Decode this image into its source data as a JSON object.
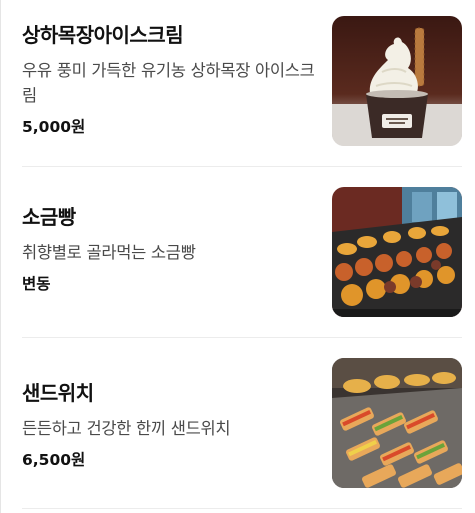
{
  "menu": {
    "items": [
      {
        "name": "상하목장아이스크림",
        "description": "우유 풍미 가득한 유기농 상하목장 아이스크림",
        "price": "5,000원",
        "image": "ice-cream-cup-photo"
      },
      {
        "name": "소금빵",
        "description": "취향별로 골라먹는 소금빵",
        "price": "변동",
        "image": "salt-bread-display-photo"
      },
      {
        "name": "샌드위치",
        "description": "든든하고 건강한 한끼 샌드위치",
        "price": "6,500원",
        "image": "sandwich-display-photo"
      }
    ]
  }
}
